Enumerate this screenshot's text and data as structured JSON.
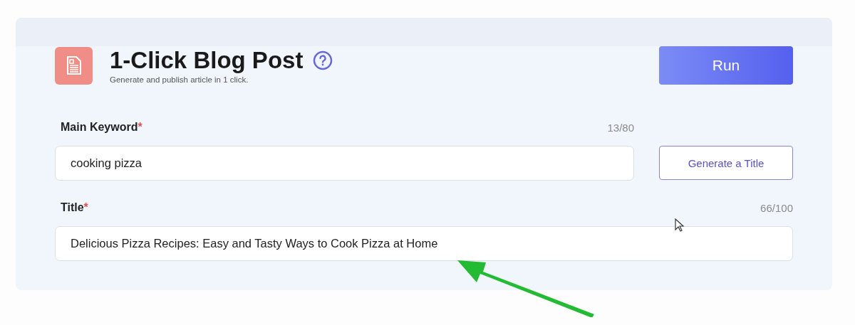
{
  "header": {
    "title": "1-Click Blog Post",
    "subtitle": "Generate and publish article in 1 click.",
    "run_button": "Run"
  },
  "fields": [
    {
      "label": "Main Keyword",
      "required_mark": "*",
      "count": "13/80",
      "value": "cooking pizza",
      "action": "Generate a Title"
    },
    {
      "label": "Title",
      "required_mark": "*",
      "count": "66/100",
      "value": "Delicious Pizza Recipes: Easy and Tasty Ways to Cook Pizza at Home"
    }
  ]
}
